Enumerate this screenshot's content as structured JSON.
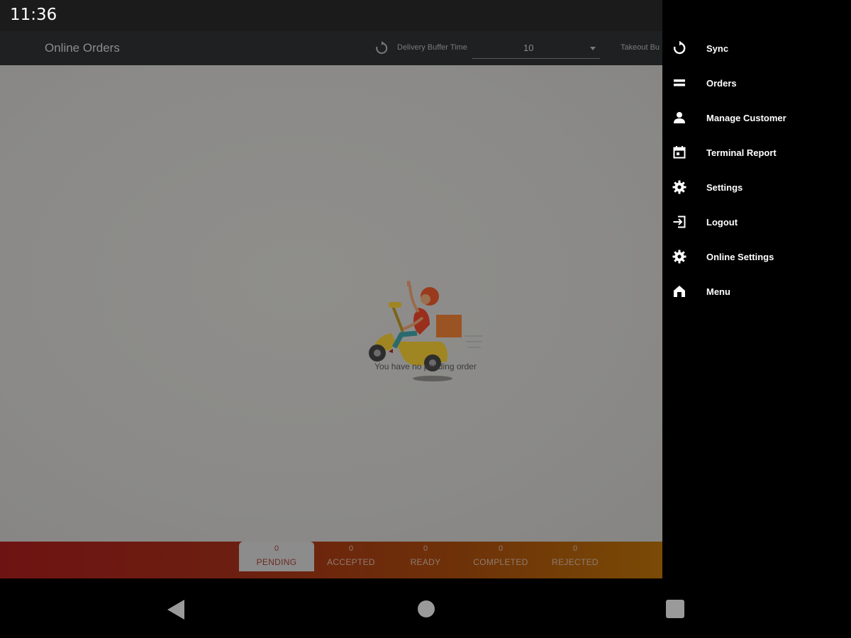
{
  "status": {
    "time": "11:36"
  },
  "toolbar": {
    "title": "Online Orders",
    "buffer_label": "Delivery Buffer Time",
    "buffer_value": "10",
    "takeout_label": "Takeout Bu"
  },
  "content": {
    "empty_message": "You have no pending order"
  },
  "tabs": [
    {
      "count": "0",
      "label": "PENDING"
    },
    {
      "count": "0",
      "label": "ACCEPTED"
    },
    {
      "count": "0",
      "label": "READY"
    },
    {
      "count": "0",
      "label": "COMPLETED"
    },
    {
      "count": "0",
      "label": "REJECTED"
    }
  ],
  "drawer": {
    "items": [
      {
        "label": "Sync",
        "icon": "sync-icon"
      },
      {
        "label": "Orders",
        "icon": "orders-icon"
      },
      {
        "label": "Manage Customer",
        "icon": "person-icon"
      },
      {
        "label": "Terminal Report",
        "icon": "calendar-icon"
      },
      {
        "label": "Settings",
        "icon": "gear-icon"
      },
      {
        "label": "Logout",
        "icon": "logout-icon"
      },
      {
        "label": "Online Settings",
        "icon": "gear-icon"
      },
      {
        "label": "Menu",
        "icon": "store-icon"
      }
    ]
  },
  "colors": {
    "tab_gradient_start": "#6e1313",
    "tab_gradient_end": "#7a4a06",
    "drawer_bg": "#000000"
  }
}
